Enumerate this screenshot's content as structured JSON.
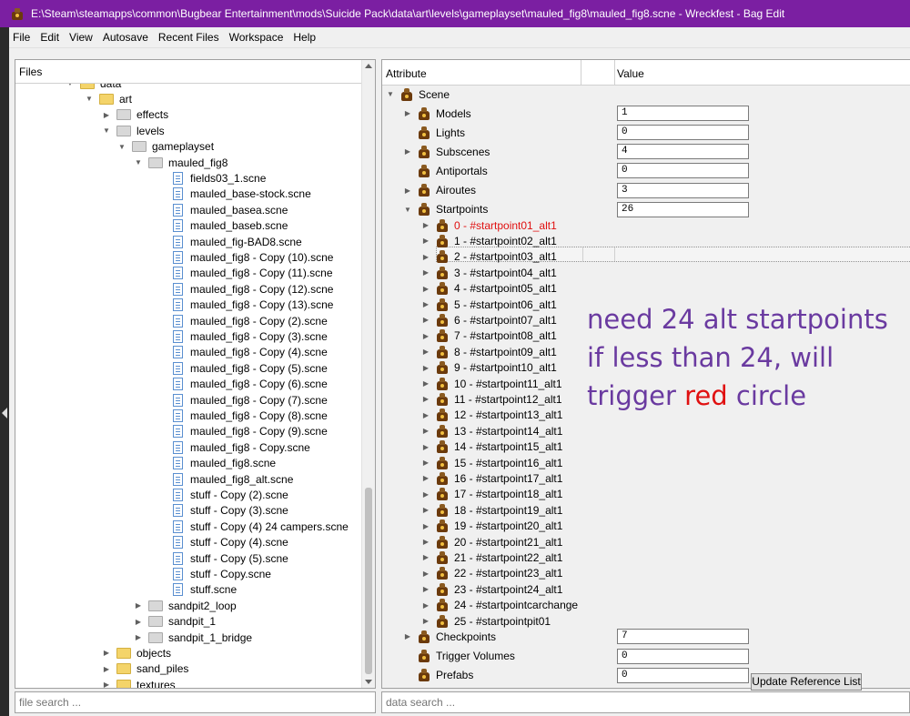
{
  "window": {
    "title": "E:\\Steam\\steamapps\\common\\Bugbear Entertainment\\mods\\Suicide Pack\\data\\art\\levels\\gameplayset\\mauled_fig8\\mauled_fig8.scne - Wreckfest - Bag Edit"
  },
  "menu": [
    "File",
    "Edit",
    "View",
    "Autosave",
    "Recent Files",
    "Workspace",
    "Help"
  ],
  "files_panel": {
    "header": "Files",
    "search_placeholder": "file search ...",
    "tree": [
      {
        "label": "data",
        "icon": "folder-yellow",
        "level": 0,
        "expander": "expanded"
      },
      {
        "label": "art",
        "icon": "folder-yellow",
        "level": 1,
        "expander": "expanded"
      },
      {
        "label": "effects",
        "icon": "folder-gray",
        "level": 2,
        "expander": "collapsed"
      },
      {
        "label": "levels",
        "icon": "folder-gray",
        "level": 2,
        "expander": "expanded"
      },
      {
        "label": "gameplayset",
        "icon": "folder-gray",
        "level": 3,
        "expander": "expanded"
      },
      {
        "label": "mauled_fig8",
        "icon": "folder-gray",
        "level": 4,
        "expander": "expanded"
      },
      {
        "label": "fields03_1.scne",
        "icon": "file",
        "level": 5
      },
      {
        "label": "mauled_base-stock.scne",
        "icon": "file",
        "level": 5
      },
      {
        "label": "mauled_basea.scne",
        "icon": "file",
        "level": 5
      },
      {
        "label": "mauled_baseb.scne",
        "icon": "file",
        "level": 5
      },
      {
        "label": "mauled_fig-BAD8.scne",
        "icon": "file",
        "level": 5
      },
      {
        "label": "mauled_fig8 - Copy (10).scne",
        "icon": "file",
        "level": 5
      },
      {
        "label": "mauled_fig8 - Copy (11).scne",
        "icon": "file",
        "level": 5
      },
      {
        "label": "mauled_fig8 - Copy (12).scne",
        "icon": "file",
        "level": 5
      },
      {
        "label": "mauled_fig8 - Copy (13).scne",
        "icon": "file",
        "level": 5
      },
      {
        "label": "mauled_fig8 - Copy (2).scne",
        "icon": "file",
        "level": 5
      },
      {
        "label": "mauled_fig8 - Copy (3).scne",
        "icon": "file",
        "level": 5
      },
      {
        "label": "mauled_fig8 - Copy (4).scne",
        "icon": "file",
        "level": 5
      },
      {
        "label": "mauled_fig8 - Copy (5).scne",
        "icon": "file",
        "level": 5
      },
      {
        "label": "mauled_fig8 - Copy (6).scne",
        "icon": "file",
        "level": 5
      },
      {
        "label": "mauled_fig8 - Copy (7).scne",
        "icon": "file",
        "level": 5
      },
      {
        "label": "mauled_fig8 - Copy (8).scne",
        "icon": "file",
        "level": 5
      },
      {
        "label": "mauled_fig8 - Copy (9).scne",
        "icon": "file",
        "level": 5
      },
      {
        "label": "mauled_fig8 - Copy.scne",
        "icon": "file",
        "level": 5
      },
      {
        "label": "mauled_fig8.scne",
        "icon": "file",
        "level": 5
      },
      {
        "label": "mauled_fig8_alt.scne",
        "icon": "file",
        "level": 5
      },
      {
        "label": "stuff - Copy (2).scne",
        "icon": "file",
        "level": 5
      },
      {
        "label": "stuff - Copy (3).scne",
        "icon": "file",
        "level": 5
      },
      {
        "label": "stuff - Copy (4) 24 campers.scne",
        "icon": "file",
        "level": 5
      },
      {
        "label": "stuff - Copy (4).scne",
        "icon": "file",
        "level": 5
      },
      {
        "label": "stuff - Copy (5).scne",
        "icon": "file",
        "level": 5
      },
      {
        "label": "stuff - Copy.scne",
        "icon": "file",
        "level": 5
      },
      {
        "label": "stuff.scne",
        "icon": "file",
        "level": 5
      },
      {
        "label": "sandpit2_loop",
        "icon": "folder-gray",
        "level": 4,
        "expander": "collapsed"
      },
      {
        "label": "sandpit_1",
        "icon": "folder-gray",
        "level": 4,
        "expander": "collapsed"
      },
      {
        "label": "sandpit_1_bridge",
        "icon": "folder-gray",
        "level": 4,
        "expander": "collapsed"
      },
      {
        "label": "objects",
        "icon": "folder-yellow",
        "level": 2,
        "expander": "collapsed"
      },
      {
        "label": "sand_piles",
        "icon": "folder-yellow",
        "level": 2,
        "expander": "collapsed"
      },
      {
        "label": "textures",
        "icon": "folder-yellow",
        "level": 2,
        "expander": "collapsed"
      }
    ]
  },
  "attr_panel": {
    "header_attribute": "Attribute",
    "header_value": "Value",
    "search_placeholder": "data search ...",
    "update_button": "Update Reference List",
    "rows": [
      {
        "label": "Scene",
        "level": 0,
        "expander": "expanded"
      },
      {
        "label": "Models",
        "level": 1,
        "expander": "collapsed",
        "value": "1"
      },
      {
        "label": "Lights",
        "level": 1,
        "value": "0"
      },
      {
        "label": "Subscenes",
        "level": 1,
        "expander": "collapsed",
        "value": "4"
      },
      {
        "label": "Antiportals",
        "level": 1,
        "value": "0"
      },
      {
        "label": "Airoutes",
        "level": 1,
        "expander": "collapsed",
        "value": "3"
      },
      {
        "label": "Startpoints",
        "level": 1,
        "expander": "expanded",
        "value": "26"
      },
      {
        "label": "0 - #startpoint01_alt1",
        "level": 2,
        "expander": "collapsed",
        "selected": true
      },
      {
        "label": "1 - #startpoint02_alt1",
        "level": 2,
        "expander": "collapsed"
      },
      {
        "label": "2 - #startpoint03_alt1",
        "level": 2,
        "expander": "collapsed"
      },
      {
        "label": "3 - #startpoint04_alt1",
        "level": 2,
        "expander": "collapsed"
      },
      {
        "label": "4 - #startpoint05_alt1",
        "level": 2,
        "expander": "collapsed"
      },
      {
        "label": "5 - #startpoint06_alt1",
        "level": 2,
        "expander": "collapsed"
      },
      {
        "label": "6 - #startpoint07_alt1",
        "level": 2,
        "expander": "collapsed"
      },
      {
        "label": "7 - #startpoint08_alt1",
        "level": 2,
        "expander": "collapsed"
      },
      {
        "label": "8 - #startpoint09_alt1",
        "level": 2,
        "expander": "collapsed"
      },
      {
        "label": "9 - #startpoint10_alt1",
        "level": 2,
        "expander": "collapsed"
      },
      {
        "label": "10 - #startpoint11_alt1",
        "level": 2,
        "expander": "collapsed"
      },
      {
        "label": "11 - #startpoint12_alt1",
        "level": 2,
        "expander": "collapsed"
      },
      {
        "label": "12 - #startpoint13_alt1",
        "level": 2,
        "expander": "collapsed"
      },
      {
        "label": "13 - #startpoint14_alt1",
        "level": 2,
        "expander": "collapsed"
      },
      {
        "label": "14 - #startpoint15_alt1",
        "level": 2,
        "expander": "collapsed"
      },
      {
        "label": "15 - #startpoint16_alt1",
        "level": 2,
        "expander": "collapsed"
      },
      {
        "label": "16 - #startpoint17_alt1",
        "level": 2,
        "expander": "collapsed"
      },
      {
        "label": "17 - #startpoint18_alt1",
        "level": 2,
        "expander": "collapsed"
      },
      {
        "label": "18 - #startpoint19_alt1",
        "level": 2,
        "expander": "collapsed"
      },
      {
        "label": "19 - #startpoint20_alt1",
        "level": 2,
        "expander": "collapsed"
      },
      {
        "label": "20 - #startpoint21_alt1",
        "level": 2,
        "expander": "collapsed"
      },
      {
        "label": "21 - #startpoint22_alt1",
        "level": 2,
        "expander": "collapsed"
      },
      {
        "label": "22 - #startpoint23_alt1",
        "level": 2,
        "expander": "collapsed"
      },
      {
        "label": "23 - #startpoint24_alt1",
        "level": 2,
        "expander": "collapsed"
      },
      {
        "label": "24 - #startpointcarchange",
        "level": 2,
        "expander": "collapsed"
      },
      {
        "label": "25 - #startpointpit01",
        "level": 2,
        "expander": "collapsed"
      },
      {
        "label": "Checkpoints",
        "level": 1,
        "expander": "collapsed",
        "value": "7"
      },
      {
        "label": "Trigger Volumes",
        "level": 1,
        "value": "0"
      },
      {
        "label": "Prefabs",
        "level": 1,
        "value": "0"
      }
    ]
  },
  "annotation": {
    "line1": "need 24 alt startpoints",
    "line2": "if less than 24, will",
    "line3_a": "trigger ",
    "line3_b": "red",
    "line3_c": " circle"
  },
  "colors": {
    "titlebar": "#7b1fa2",
    "annotation_text": "#6a3aa0",
    "annotation_highlight": "#e01010",
    "selected_row_text": "#e01010"
  }
}
